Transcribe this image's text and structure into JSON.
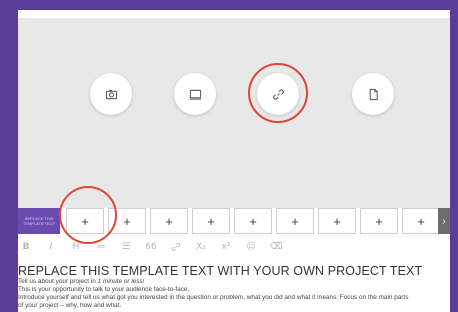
{
  "media_buttons": [
    {
      "name": "camera-icon",
      "label": "camera"
    },
    {
      "name": "screen-icon",
      "label": "screen"
    },
    {
      "name": "link-icon",
      "label": "link"
    },
    {
      "name": "file-icon",
      "label": "file"
    }
  ],
  "thumbnail": {
    "title": "REPLACE THIS TEMPLATE TEXT"
  },
  "add_slots": [
    "+",
    "+",
    "+",
    "+",
    "+",
    "+",
    "+",
    "+",
    "+"
  ],
  "scroll_arrow": "›",
  "toolbar": {
    "bold": "B",
    "italic": "I",
    "heading": "H",
    "ordered_list": "≔",
    "bullet_list": "☰",
    "quote": "66",
    "link": "🔗",
    "subscript": "X₂",
    "superscript": "x²",
    "emoji": "☺",
    "clear": "⌫"
  },
  "editor": {
    "title": "REPLACE THIS TEMPLATE TEXT WITH YOUR OWN PROJECT TEXT",
    "line1_prefix": "Tell us about your project in ",
    "line1_em": "1 minute or less!",
    "line2": "This is your opportunity to talk to your audience face-to-face.",
    "line3": "Introduce yourself and tell us what got you interested in the question or problem, what you did and what it means. Focus on the main parts",
    "line4": "of your project – why, how and what."
  },
  "colors": {
    "background": "#5b3d99",
    "accent_ring": "#e0443a",
    "media_bg": "#e8e8e8"
  }
}
